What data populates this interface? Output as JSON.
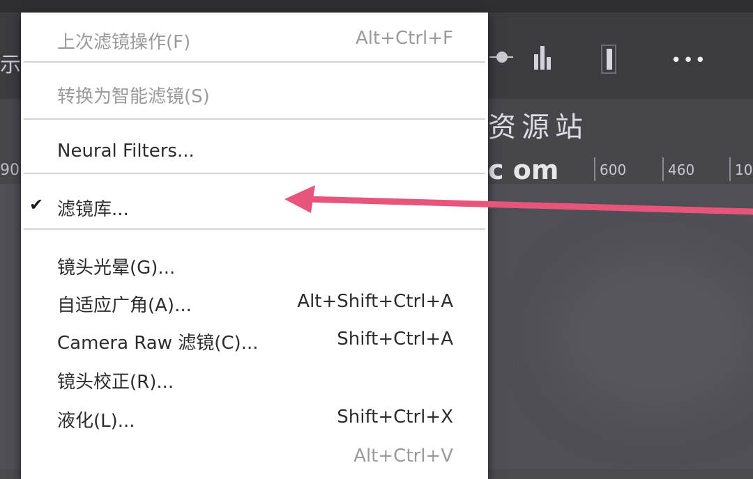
{
  "menu": {
    "items": [
      {
        "label": "上次滤镜操作(F)",
        "shortcut": "Alt+Ctrl+F",
        "disabled": true,
        "checked": false
      },
      {
        "label": "转换为智能滤镜(S)",
        "shortcut": "",
        "disabled": true,
        "checked": false
      },
      {
        "label": "Neural Filters...",
        "shortcut": "",
        "disabled": false,
        "checked": false
      },
      {
        "label": "滤镜库...",
        "shortcut": "",
        "disabled": false,
        "checked": true
      },
      {
        "label": "镜头光晕(G)...",
        "shortcut": "",
        "disabled": false,
        "checked": false
      },
      {
        "label": "自适应广角(A)...",
        "shortcut": "Alt+Shift+Ctrl+A",
        "disabled": false,
        "checked": false
      },
      {
        "label": "Camera Raw 滤镜(C)...",
        "shortcut": "Shift+Ctrl+A",
        "disabled": false,
        "checked": false
      },
      {
        "label": "镜头校正(R)...",
        "shortcut": "",
        "disabled": false,
        "checked": false
      },
      {
        "label": "液化(L)...",
        "shortcut": "Shift+Ctrl+X",
        "disabled": false,
        "checked": false
      },
      {
        "label": "",
        "shortcut": "Alt+Ctrl+V",
        "disabled": true,
        "checked": false
      }
    ],
    "check_glyph": "✔"
  },
  "background": {
    "left_glyph_top": "示",
    "left_glyph_bottom": "90",
    "watermark_title": "资源站",
    "watermark_domain": "c om",
    "ticks": [
      "600",
      "460",
      "10"
    ],
    "more_icon": "•••"
  },
  "colors": {
    "arrow": "#e8557a",
    "menu_bg": "#ffffff",
    "app_bg": "#4a4a4f"
  },
  "icons": [
    "checkmark-icon",
    "more-icon",
    "arrow-annotation"
  ]
}
